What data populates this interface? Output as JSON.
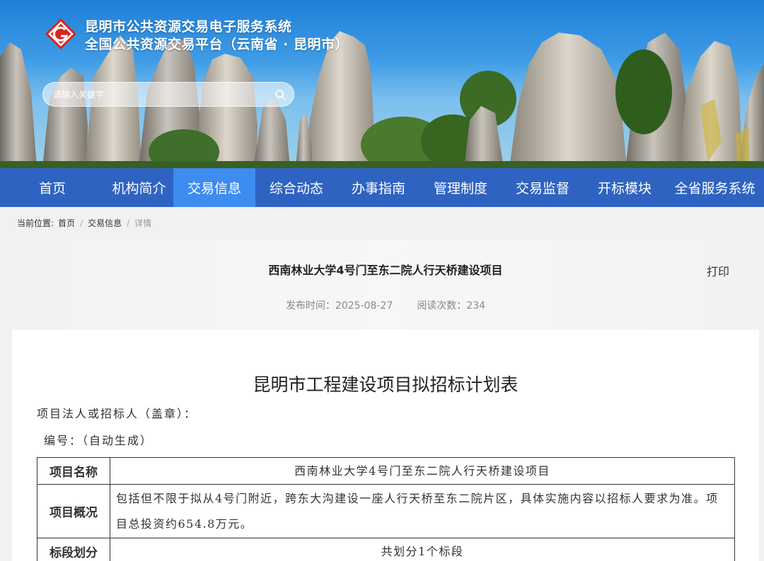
{
  "site": {
    "title_line1": "昆明市公共资源交易电子服务系统",
    "title_line2": "全国公共资源交易平台（云南省 · 昆明市）",
    "logo_icon": "platform-logo-icon",
    "accent_color": "#2e63c2",
    "active_color": "#3d8cf0"
  },
  "search": {
    "placeholder": "请输入关键字",
    "icon": "search-icon"
  },
  "nav": {
    "items": [
      {
        "label": "首页"
      },
      {
        "label": "机构简介"
      },
      {
        "label": "交易信息",
        "active": true
      },
      {
        "label": "综合动态"
      },
      {
        "label": "办事指南"
      },
      {
        "label": "管理制度"
      },
      {
        "label": "交易监督"
      },
      {
        "label": "开标模块"
      },
      {
        "label": "全省服务系统"
      }
    ]
  },
  "breadcrumb": {
    "prefix": "当前位置:",
    "items": [
      "首页",
      "交易信息",
      "详情"
    ]
  },
  "article": {
    "title": "西南林业大学4号门至东二院人行天桥建设项目",
    "print_label": "打印",
    "publish_time": "发布时间：2025-08-27",
    "read_count": "阅读次数：234"
  },
  "document": {
    "title": "昆明市工程建设项目拟招标计划表",
    "tenderer_line": "项目法人或招标人（盖章）：",
    "number_line": "编号：（自动生成）",
    "table": [
      {
        "key": "项目名称",
        "value": "西南林业大学4号门至东二院人行天桥建设项目",
        "center": true
      },
      {
        "key": "项目概况",
        "value": "包括但不限于拟从4号门附近，跨东大沟建设一座人行天桥至东二院片区，具体实施内容以招标人要求为准。项目总投资约654.8万元。",
        "center": false
      },
      {
        "key": "标段划分",
        "value": "共划分1个标段",
        "center": true
      }
    ]
  }
}
